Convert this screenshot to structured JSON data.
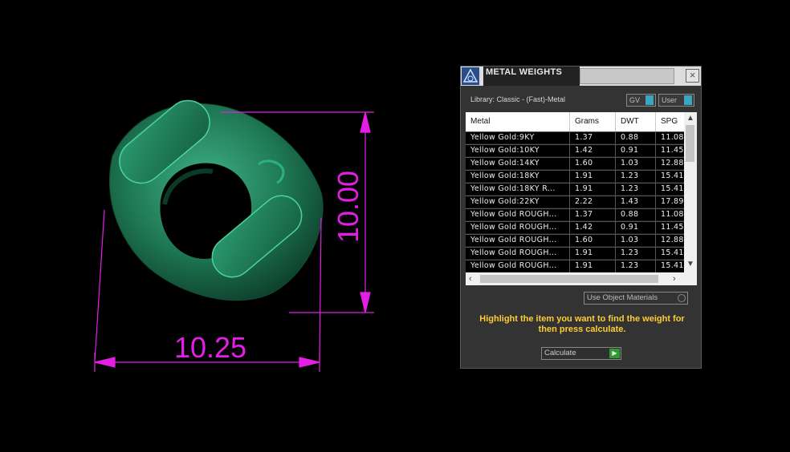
{
  "viewport": {
    "dimension_horizontal": "10.25",
    "dimension_vertical": "10.00",
    "colors": {
      "dimension": "#e51ee5",
      "model": "#1f7a55",
      "background": "#000000"
    }
  },
  "panel": {
    "title": "METAL WEIGHTS",
    "close_label": "×",
    "library_label": "Library: Classic - (Fast)-Metal",
    "toggle_gv": "GV",
    "toggle_user": "User",
    "columns": [
      "Metal",
      "Grams",
      "DWT",
      "SPG"
    ],
    "rows": [
      [
        "Yellow Gold:9KY",
        "1.37",
        "0.88",
        "11.08"
      ],
      [
        "Yellow Gold:10KY",
        "1.42",
        "0.91",
        "11.45"
      ],
      [
        "Yellow Gold:14KY",
        "1.60",
        "1.03",
        "12.88"
      ],
      [
        "Yellow Gold:18KY",
        "1.91",
        "1.23",
        "15.41"
      ],
      [
        "Yellow Gold:18KY R...",
        "1.91",
        "1.23",
        "15.41"
      ],
      [
        "Yellow Gold:22KY",
        "2.22",
        "1.43",
        "17.89"
      ],
      [
        "Yellow Gold ROUGH...",
        "1.37",
        "0.88",
        "11.08"
      ],
      [
        "Yellow Gold ROUGH...",
        "1.42",
        "0.91",
        "11.45"
      ],
      [
        "Yellow Gold ROUGH...",
        "1.60",
        "1.03",
        "12.88"
      ],
      [
        "Yellow Gold ROUGH...",
        "1.91",
        "1.23",
        "15.41"
      ],
      [
        "Yellow Gold ROUGH...",
        "1.91",
        "1.23",
        "15.41"
      ]
    ],
    "use_object_materials": "Use Object Materials",
    "hint": "Highlight the item you want to find the weight for then press calculate.",
    "calculate_label": "Calculate",
    "accent_color": "#ffcc33"
  }
}
